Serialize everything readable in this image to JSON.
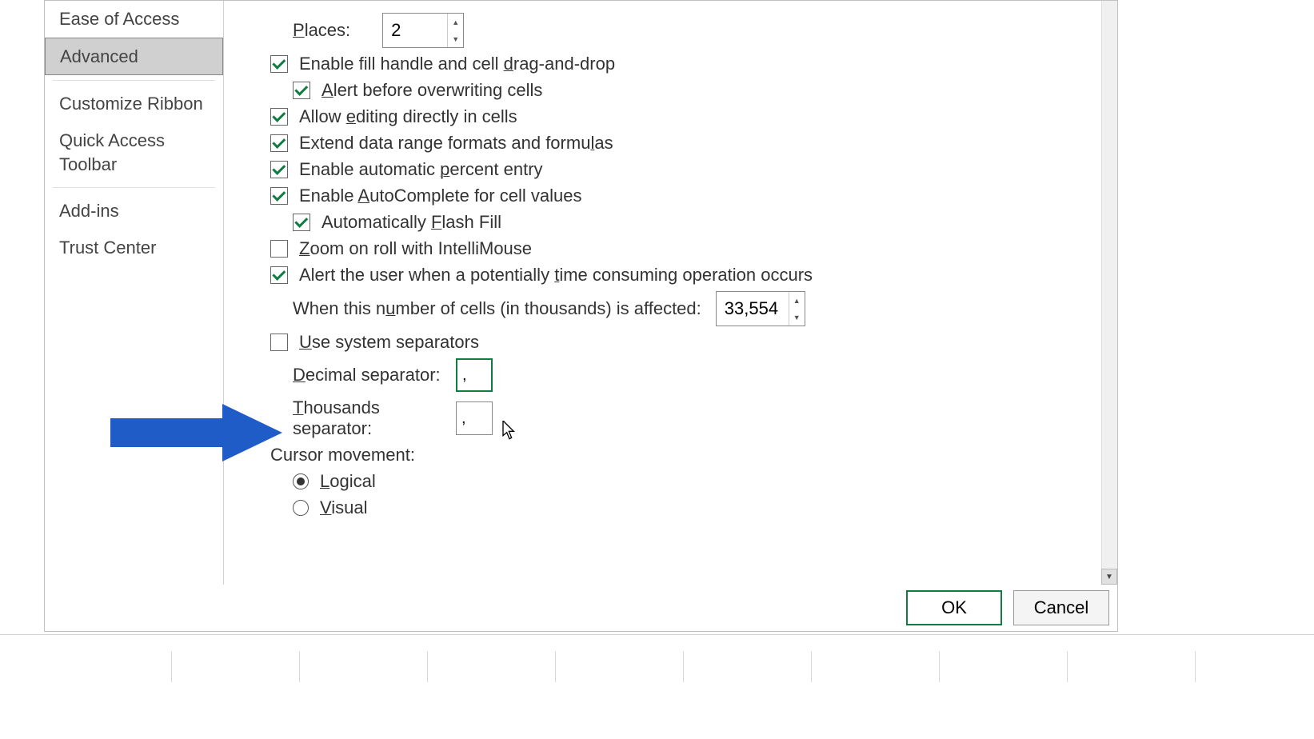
{
  "sidebar": {
    "items": [
      {
        "label": "Ease of Access",
        "selected": false
      },
      {
        "label": "Advanced",
        "selected": true
      },
      {
        "label": "Customize Ribbon",
        "selected": false
      },
      {
        "label": "Quick Access Toolbar",
        "selected": false
      },
      {
        "label": "Add-ins",
        "selected": false
      },
      {
        "label": "Trust Center",
        "selected": false
      }
    ]
  },
  "options": {
    "places_label": "Places:",
    "places_value": "2",
    "fill_handle": {
      "checked": true,
      "pre": "Enable fill handle and cell ",
      "u": "d",
      "post": "rag-and-drop"
    },
    "alert_overwrite": {
      "checked": true,
      "u": "A",
      "post": "lert before overwriting cells"
    },
    "allow_editing": {
      "checked": true,
      "pre": "Allow ",
      "u": "e",
      "post": "diting directly in cells"
    },
    "extend_range": {
      "checked": true,
      "pre": "Extend data range formats and formu",
      "u": "l",
      "post": "as"
    },
    "auto_percent": {
      "checked": true,
      "pre": "Enable automatic ",
      "u": "p",
      "post": "ercent entry"
    },
    "autocomplete": {
      "checked": true,
      "pre": "Enable ",
      "u": "A",
      "post": "utoComplete for cell values"
    },
    "flash_fill": {
      "checked": true,
      "pre": "Automatically ",
      "u": "F",
      "post": "lash Fill"
    },
    "zoom_intelli": {
      "checked": false,
      "u": "Z",
      "post": "oom on roll with IntelliMouse"
    },
    "alert_time": {
      "checked": true,
      "pre": "Alert the user when a potentially ",
      "u": "t",
      "post": "ime consuming operation occurs"
    },
    "cells_affected_label_pre": "When this n",
    "cells_affected_label_u": "u",
    "cells_affected_label_post": "mber of cells (in thousands) is affected:",
    "cells_affected_value": "33,554",
    "use_sys_sep": {
      "checked": false,
      "u": "U",
      "post": "se system separators"
    },
    "decimal_sep_label_u": "D",
    "decimal_sep_label_post": "ecimal separator:",
    "decimal_sep_value": ",",
    "thousands_sep_label_u": "T",
    "thousands_sep_label_post": "housands separator:",
    "thousands_sep_value": ",",
    "cursor_movement_label": "Cursor movement:",
    "logical": {
      "checked": true,
      "u": "L",
      "post": "ogical"
    },
    "visual": {
      "checked": false,
      "u": "V",
      "post": "isual"
    }
  },
  "buttons": {
    "ok": "OK",
    "cancel": "Cancel"
  }
}
